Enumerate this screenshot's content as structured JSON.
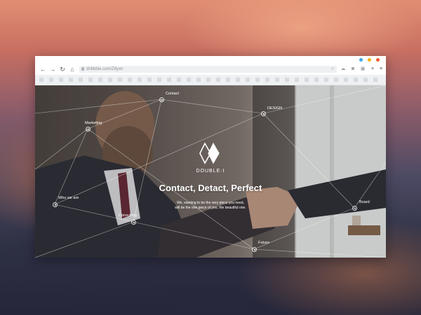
{
  "browser": {
    "url": "dribbble.com/Z8yxn",
    "buttons": {
      "back": "←",
      "forward": "→",
      "reload": "↻",
      "home": "⌂"
    },
    "icons": [
      "download-icon",
      "camera-icon",
      "cloud-icon",
      "image-icon",
      "shield-icon",
      "heart-icon",
      "menu-icon"
    ]
  },
  "site": {
    "brand": "DOUBLE·I",
    "headline": "Contact, Detact, Perfect",
    "tagline_line1": "We, wanting to be the very piece you need,",
    "tagline_line2": "will be the one piece of you, the beautiful one.",
    "nodes": {
      "contact": "Contact",
      "design": "DESIGN",
      "marketing": "Marketing",
      "who_we_are": "Who we are",
      "consulting": "Consulting",
      "board": "Board",
      "future": "Future"
    }
  },
  "colors": {
    "accent_blue": "#3aa9ea",
    "accent_yellow": "#f4b21a",
    "accent_red": "#ef5b2f"
  }
}
